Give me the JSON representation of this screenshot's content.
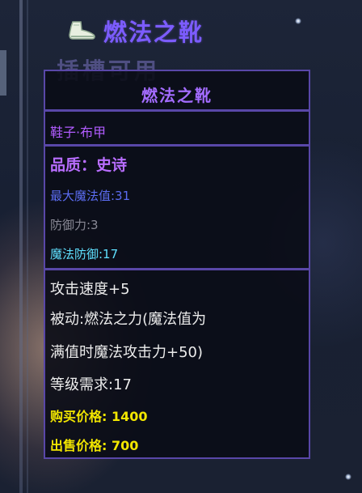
{
  "header": {
    "item_name": "燃法之靴",
    "icon": "boot-icon"
  },
  "background": {
    "slot_text": "插槽可用"
  },
  "tooltip": {
    "title": "燃法之靴",
    "type": "鞋子·布甲",
    "quality": "品质：史诗",
    "max_mana": "最大魔法值:31",
    "defense": "防御力:3",
    "magic_defense": "魔法防御:17",
    "attack_speed": "攻击速度+5",
    "passive_line1": "被动:燃法之力(魔法值为",
    "passive_line2": "满值时魔法攻击力+50)",
    "level_req": "等级需求:17",
    "buy_price": "购买价格: 1400",
    "sell_price": "出售价格: 700"
  },
  "colors": {
    "epic_purple": "#a36cff",
    "mana_blue": "#5b6cf0",
    "magic_defense_cyan": "#5fe0ff",
    "price_yellow": "#f2e600",
    "border": "#5947a8"
  }
}
